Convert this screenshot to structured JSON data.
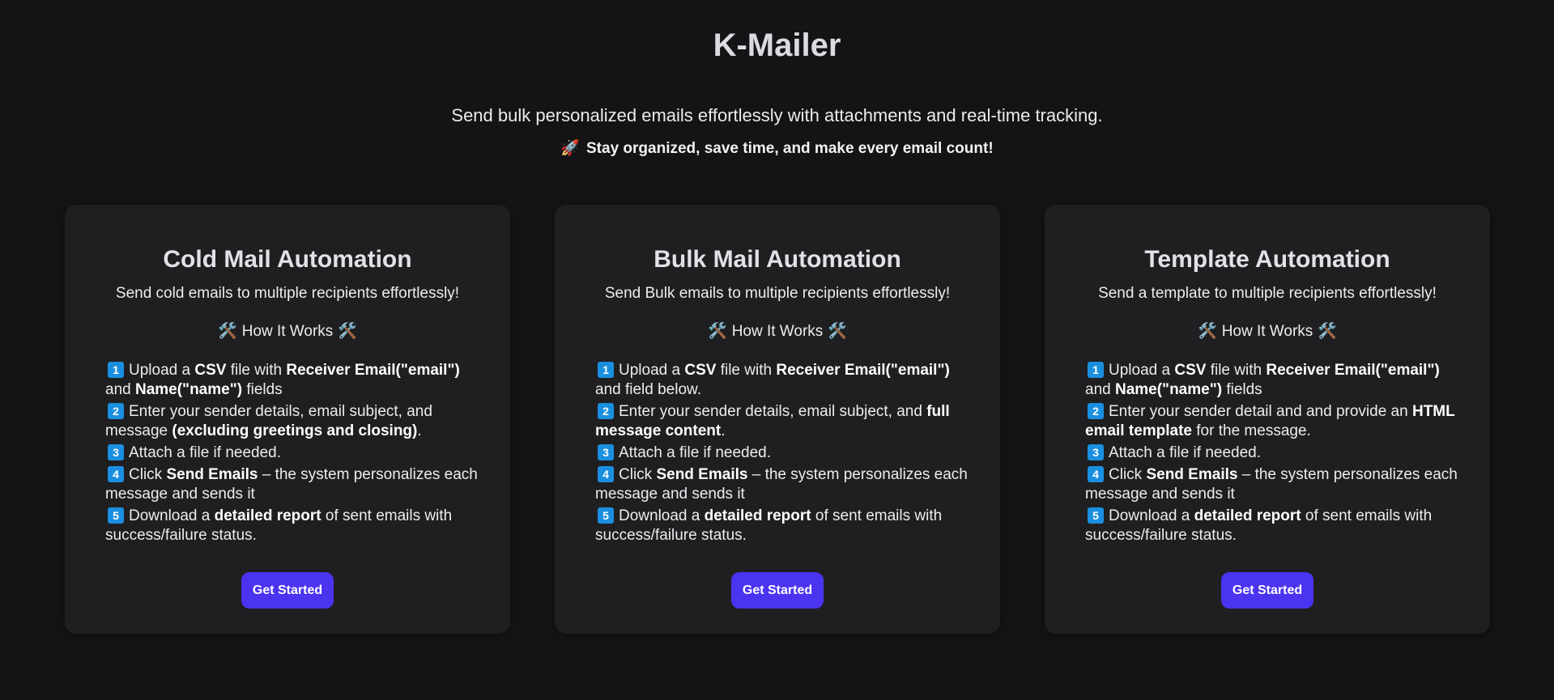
{
  "header": {
    "title": "K-Mailer",
    "tagline": "Send bulk personalized emails effortlessly with attachments and real-time tracking.",
    "subline_icon": "🚀",
    "subline": "Stay organized, save time, and make every email count!"
  },
  "cards": [
    {
      "title": "Cold Mail Automation",
      "desc": "Send cold emails to multiple recipients effortlessly!",
      "how_label": "How It Works",
      "how_icon": "🛠️",
      "steps": [
        {
          "n": "1",
          "parts": [
            [
              "Upload a ",
              false
            ],
            [
              "CSV",
              true
            ],
            [
              " file with ",
              false
            ],
            [
              "Receiver Email(\"email\")",
              true
            ],
            [
              " and ",
              false
            ],
            [
              "Name(\"name\")",
              true
            ],
            [
              " fields",
              false
            ]
          ]
        },
        {
          "n": "2",
          "parts": [
            [
              "Enter your sender details, email subject, and message ",
              false
            ],
            [
              "(excluding greetings and closing)",
              true
            ],
            [
              ".",
              false
            ]
          ]
        },
        {
          "n": "3",
          "parts": [
            [
              "Attach a file if needed.",
              false
            ]
          ]
        },
        {
          "n": "4",
          "parts": [
            [
              "Click ",
              false
            ],
            [
              "Send Emails",
              true
            ],
            [
              " – the system personalizes each message and sends it",
              false
            ]
          ]
        },
        {
          "n": "5",
          "parts": [
            [
              "Download a ",
              false
            ],
            [
              "detailed report",
              true
            ],
            [
              " of sent emails with success/failure status.",
              false
            ]
          ]
        }
      ],
      "button": "Get Started"
    },
    {
      "title": "Bulk Mail Automation",
      "desc": "Send Bulk emails to multiple recipients effortlessly!",
      "how_label": "How It Works",
      "how_icon": "🛠️",
      "steps": [
        {
          "n": "1",
          "parts": [
            [
              "Upload a ",
              false
            ],
            [
              "CSV",
              true
            ],
            [
              " file with ",
              false
            ],
            [
              "Receiver Email(\"email\")",
              true
            ],
            [
              " and field below.",
              false
            ]
          ]
        },
        {
          "n": "2",
          "parts": [
            [
              "Enter your sender details, email subject, and ",
              false
            ],
            [
              "full message content",
              true
            ],
            [
              ".",
              false
            ]
          ]
        },
        {
          "n": "3",
          "parts": [
            [
              "Attach a file if needed.",
              false
            ]
          ]
        },
        {
          "n": "4",
          "parts": [
            [
              "Click ",
              false
            ],
            [
              "Send Emails",
              true
            ],
            [
              " – the system personalizes each message and sends it",
              false
            ]
          ]
        },
        {
          "n": "5",
          "parts": [
            [
              "Download a ",
              false
            ],
            [
              "detailed report",
              true
            ],
            [
              " of sent emails with success/failure status.",
              false
            ]
          ]
        }
      ],
      "button": "Get Started"
    },
    {
      "title": "Template Automation",
      "desc": "Send a template to multiple recipients effortlessly!",
      "how_label": "How It Works",
      "how_icon": "🛠️",
      "steps": [
        {
          "n": "1",
          "parts": [
            [
              "Upload a ",
              false
            ],
            [
              "CSV",
              true
            ],
            [
              " file with ",
              false
            ],
            [
              "Receiver Email(\"email\")",
              true
            ],
            [
              " and ",
              false
            ],
            [
              "Name(\"name\")",
              true
            ],
            [
              " fields",
              false
            ]
          ]
        },
        {
          "n": "2",
          "parts": [
            [
              "Enter your sender detail and and provide an ",
              false
            ],
            [
              "HTML email template",
              true
            ],
            [
              " for the message.",
              false
            ]
          ]
        },
        {
          "n": "3",
          "parts": [
            [
              "Attach a file if needed.",
              false
            ]
          ]
        },
        {
          "n": "4",
          "parts": [
            [
              "Click ",
              false
            ],
            [
              "Send Emails",
              true
            ],
            [
              " – the system personalizes each message and sends it",
              false
            ]
          ]
        },
        {
          "n": "5",
          "parts": [
            [
              "Download a ",
              false
            ],
            [
              "detailed report",
              true
            ],
            [
              " of sent emails with success/failure status.",
              false
            ]
          ]
        }
      ],
      "button": "Get Started"
    }
  ],
  "colors": {
    "background": "#141416",
    "card": "#1f1f21",
    "button": "#4a34f0",
    "step_badge": "#1a8fe0"
  }
}
